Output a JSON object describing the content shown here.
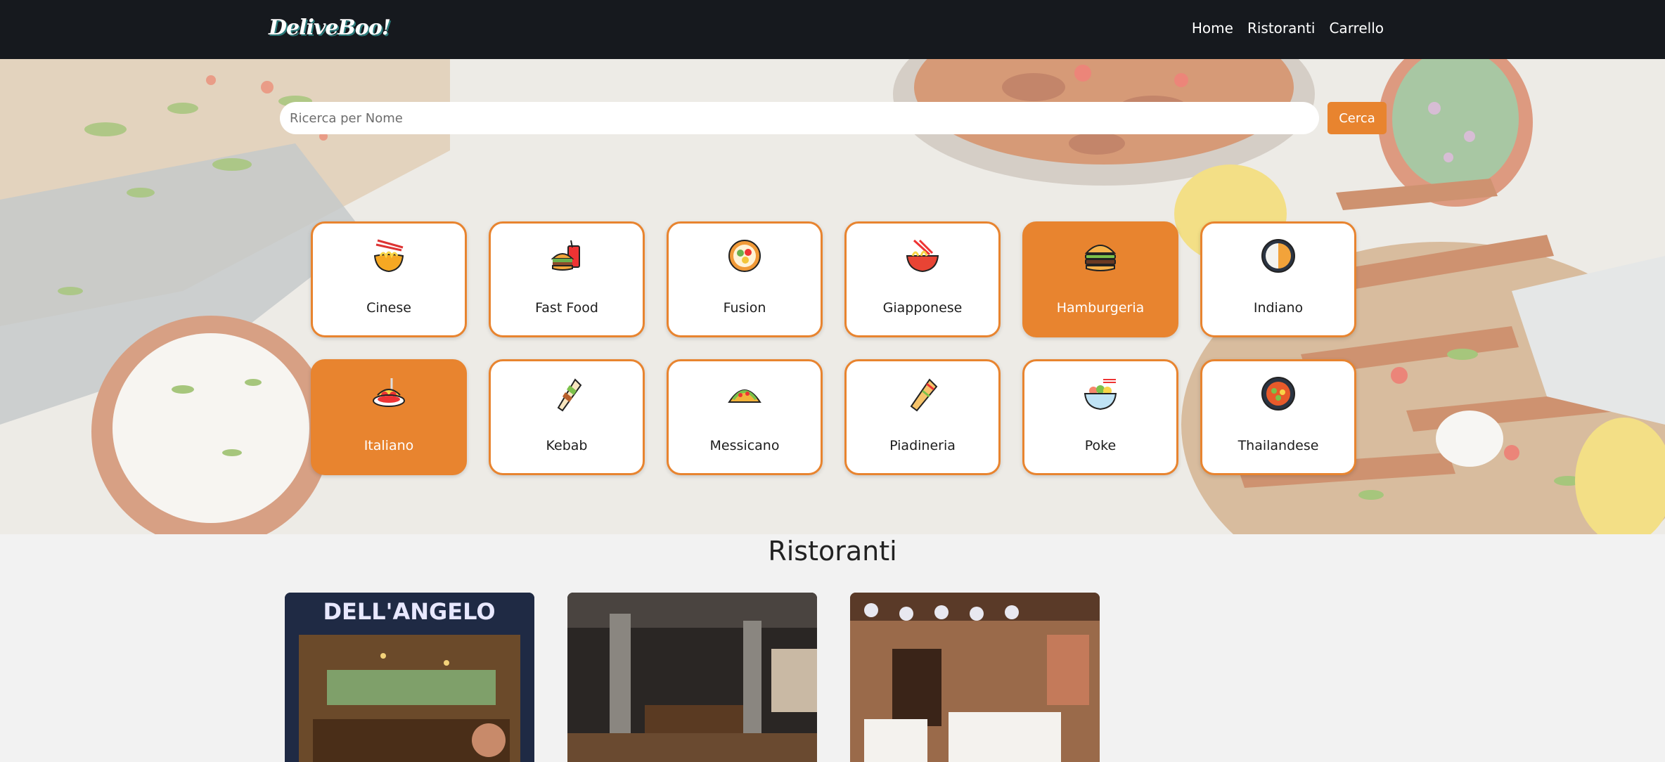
{
  "navbar": {
    "logo": "DeliveBoo!",
    "links": [
      "Home",
      "Ristoranti",
      "Carrello"
    ]
  },
  "search": {
    "placeholder": "Ricerca per Nome",
    "button_label": "Cerca"
  },
  "categories": [
    {
      "label": "Cinese",
      "icon": "noodle-bowl-icon",
      "active": false
    },
    {
      "label": "Fast Food",
      "icon": "fast-food-icon",
      "active": false
    },
    {
      "label": "Fusion",
      "icon": "fusion-plate-icon",
      "active": false
    },
    {
      "label": "Giapponese",
      "icon": "ramen-icon",
      "active": false
    },
    {
      "label": "Hamburgeria",
      "icon": "burger-icon",
      "active": true
    },
    {
      "label": "Indiano",
      "icon": "curry-icon",
      "active": false
    },
    {
      "label": "Italiano",
      "icon": "spaghetti-icon",
      "active": true
    },
    {
      "label": "Kebab",
      "icon": "kebab-wrap-icon",
      "active": false
    },
    {
      "label": "Messicano",
      "icon": "taco-icon",
      "active": false
    },
    {
      "label": "Piadineria",
      "icon": "piadina-icon",
      "active": false
    },
    {
      "label": "Poke",
      "icon": "poke-bowl-icon",
      "active": false
    },
    {
      "label": "Thailandese",
      "icon": "thai-dish-icon",
      "active": false
    }
  ],
  "restaurants": {
    "title": "Ristoranti",
    "cards": [
      {
        "sign": "DELL'ANGELO"
      },
      {
        "sign": ""
      },
      {
        "sign": ""
      }
    ]
  },
  "colors": {
    "accent": "#e8842f",
    "navbar": "#16191e",
    "page_bg": "#f2f2f2"
  }
}
